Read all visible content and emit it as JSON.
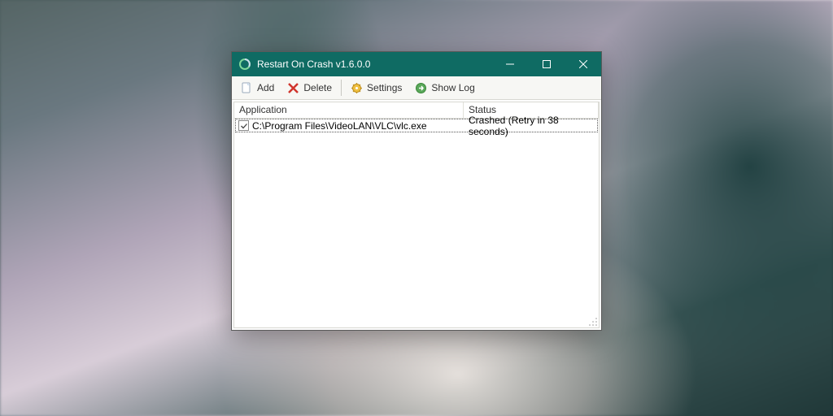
{
  "window": {
    "title": "Restart On Crash v1.6.0.0"
  },
  "toolbar": {
    "add_label": "Add",
    "delete_label": "Delete",
    "settings_label": "Settings",
    "showlog_label": "Show Log"
  },
  "list": {
    "header": {
      "application": "Application",
      "status": "Status"
    },
    "rows": [
      {
        "checked": true,
        "application": "C:\\Program Files\\VideoLAN\\VLC\\vlc.exe",
        "status": "Crashed (Retry in 38 seconds)"
      }
    ]
  }
}
